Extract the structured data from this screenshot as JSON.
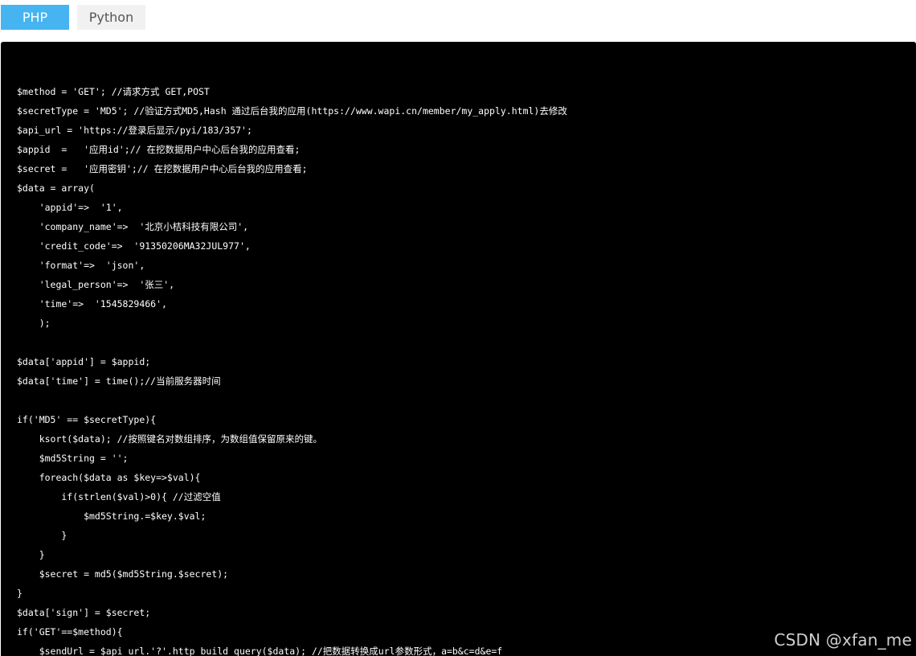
{
  "tabs": [
    {
      "label": "PHP",
      "active": true
    },
    {
      "label": "Python",
      "active": false
    }
  ],
  "code_lines": [
    "$method = 'GET'; //请求方式 GET,POST",
    "$secretType = 'MD5'; //验证方式MD5,Hash 通过后台我的应用(https://www.wapi.cn/member/my_apply.html)去修改",
    "$api_url = 'https://登录后显示/pyi/183/357';",
    "$appid  =   '应用id';// 在挖数据用户中心后台我的应用查看;",
    "$secret =   '应用密钥';// 在挖数据用户中心后台我的应用查看;",
    "$data = array(",
    "    'appid'=>  '1',",
    "    'company_name'=>  '北京小桔科技有限公司',",
    "    'credit_code'=>  '91350206MA32JUL977',",
    "    'format'=>  'json',",
    "    'legal_person'=>  '张三',",
    "    'time'=>  '1545829466',",
    "    );",
    "",
    "$data['appid'] = $appid;",
    "$data['time'] = time();//当前服务器时间",
    "",
    "if('MD5' == $secretType){",
    "    ksort($data); //按照键名对数组排序，为数组值保留原来的键。",
    "    $md5String = '';",
    "    foreach($data as $key=>$val){",
    "        if(strlen($val)>0){ //过滤空值",
    "            $md5String.=$key.$val;",
    "        }",
    "    }",
    "    $secret = md5($md5String.$secret);",
    "}",
    "$data['sign'] = $secret;",
    "if('GET'==$method){",
    "    $sendUrl = $api_url.'?'.http_build_query($data); //把数据转换成url参数形式，a=b&c=d&e=f"
  ],
  "watermark": "CSDN @xfan_me",
  "colors": {
    "active_tab": "#45b4f1",
    "inactive_tab": "#f1f1f1",
    "code_background": "#000000",
    "code_text": "#ffffff"
  }
}
